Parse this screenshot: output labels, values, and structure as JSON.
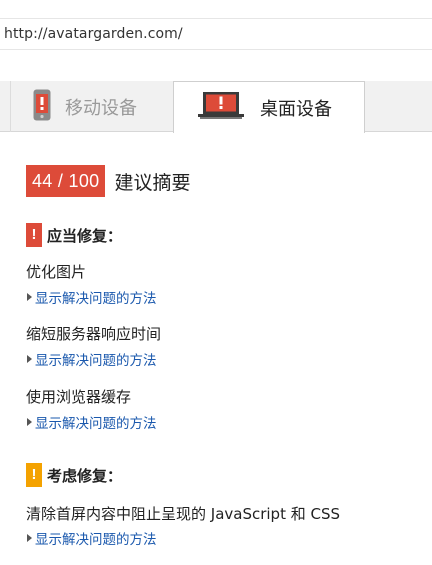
{
  "address_bar": {
    "url": "http://avatargarden.com/"
  },
  "tabs": [
    {
      "label": "移动设备",
      "icon": "mobile-phone-icon",
      "active": false
    },
    {
      "label": "桌面设备",
      "icon": "laptop-icon",
      "active": true
    }
  ],
  "summary": {
    "score": "44 / 100",
    "title": "建议摘要",
    "score_color": "#dd4b39"
  },
  "should_fix": {
    "title": "应当修复：",
    "color": "#dd4b39",
    "rules": [
      {
        "title": "优化图片",
        "link": "显示解决问题的方法"
      },
      {
        "title": "缩短服务器响应时间",
        "link": "显示解决问题的方法"
      },
      {
        "title": "使用浏览器缓存",
        "link": "显示解决问题的方法"
      }
    ]
  },
  "consider_fixing": {
    "title": "考虑修复：",
    "color": "#f4a200",
    "rules": [
      {
        "title": "清除首屏内容中阻止呈现的 JavaScript 和 CSS",
        "link": "显示解决问题的方法"
      }
    ]
  }
}
